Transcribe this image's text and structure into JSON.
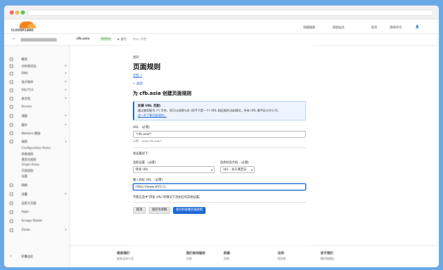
{
  "browser": {
    "dots": [
      "#ee6a5f",
      "#f5bd4f",
      "#61c454"
    ]
  },
  "dashboard": {
    "logo_text": "CLOUDFLARE",
    "top_links": [
      "快捷搜索",
      "添加站点",
      "支持",
      "简体中文"
    ],
    "domain": "cfb.asia",
    "badge": "Active",
    "star": "★ 星号",
    "plan": "Free 计划",
    "sidebar_items": [
      {
        "label": "概述",
        "chev": false
      },
      {
        "label": "分析和日志",
        "chev": true
      },
      {
        "label": "DNS",
        "chev": true
      },
      {
        "label": "电子邮件",
        "chev": true
      },
      {
        "label": "SSL/TLS",
        "chev": true
      },
      {
        "label": "安全性",
        "chev": true
      },
      {
        "label": "Access",
        "chev": false
      },
      {
        "label": "速度",
        "chev": true
      },
      {
        "label": "缓存",
        "chev": true
      },
      {
        "label": "Workers 路由",
        "chev": false
      },
      {
        "label": "规则",
        "chev": true
      }
    ],
    "sidebar_subitems": [
      "Configuration Rules",
      "转换规则",
      "重定向规则",
      "Origin Rules",
      "页面规则",
      "设置"
    ],
    "sidebar_items_after": [
      {
        "label": "网络",
        "chev": false
      },
      {
        "label": "流量",
        "chev": true
      },
      {
        "label": "自定义页面",
        "chev": false
      },
      {
        "label": "Apps",
        "chev": false
      },
      {
        "label": "Scrape Shield",
        "chev": false
      },
      {
        "label": "Zaraz",
        "chev": true
      }
    ],
    "collapse_label": "折叠边栏",
    "footer": [
      {
        "h": "联系我们",
        "l": "联系支持人员"
      },
      {
        "h": "我们有何服务",
        "l": "计划"
      },
      {
        "h": "资源",
        "l": "文档"
      },
      {
        "h": "支持",
        "l": "知识库"
      },
      {
        "h": "关于我们",
        "l": "我们的团队"
      }
    ]
  },
  "modal": {
    "section": "规则",
    "title": "页面规则",
    "doc_link": "文档",
    "back": "← 返回",
    "subtitle": "为 cfb.asia 创建页面规则",
    "info": {
      "heading": "如果 URL 匹配:",
      "text": "通过使用星号 (*) 字符，您可以创建与多 (而不只是一个) URL 相匹配的动态模式。所有 URL 都不区分大小写。",
      "link": "进一步了解页面规则。"
    },
    "url_label": "URL （必需）",
    "url_value": "*cfb.asia/*",
    "url_hint": "示例： www.cfb.asia/*",
    "then_label": "则设置如下:",
    "setting_label": "选取设置 （必需）",
    "setting_value": "转发 URL",
    "status_label": "选择状态代码 （必需）",
    "status_value": "301 - 永久重定向",
    "dest_label": "输入目标 URL （必需）",
    "dest_value": "https://www.ahi5.cn",
    "note": "不能在选中\"转发 URL\"的情况下添加任何其他设置。",
    "buttons": {
      "cancel": "取消",
      "draft": "保存为草稿",
      "deploy": "保存和部署页面规则"
    }
  }
}
